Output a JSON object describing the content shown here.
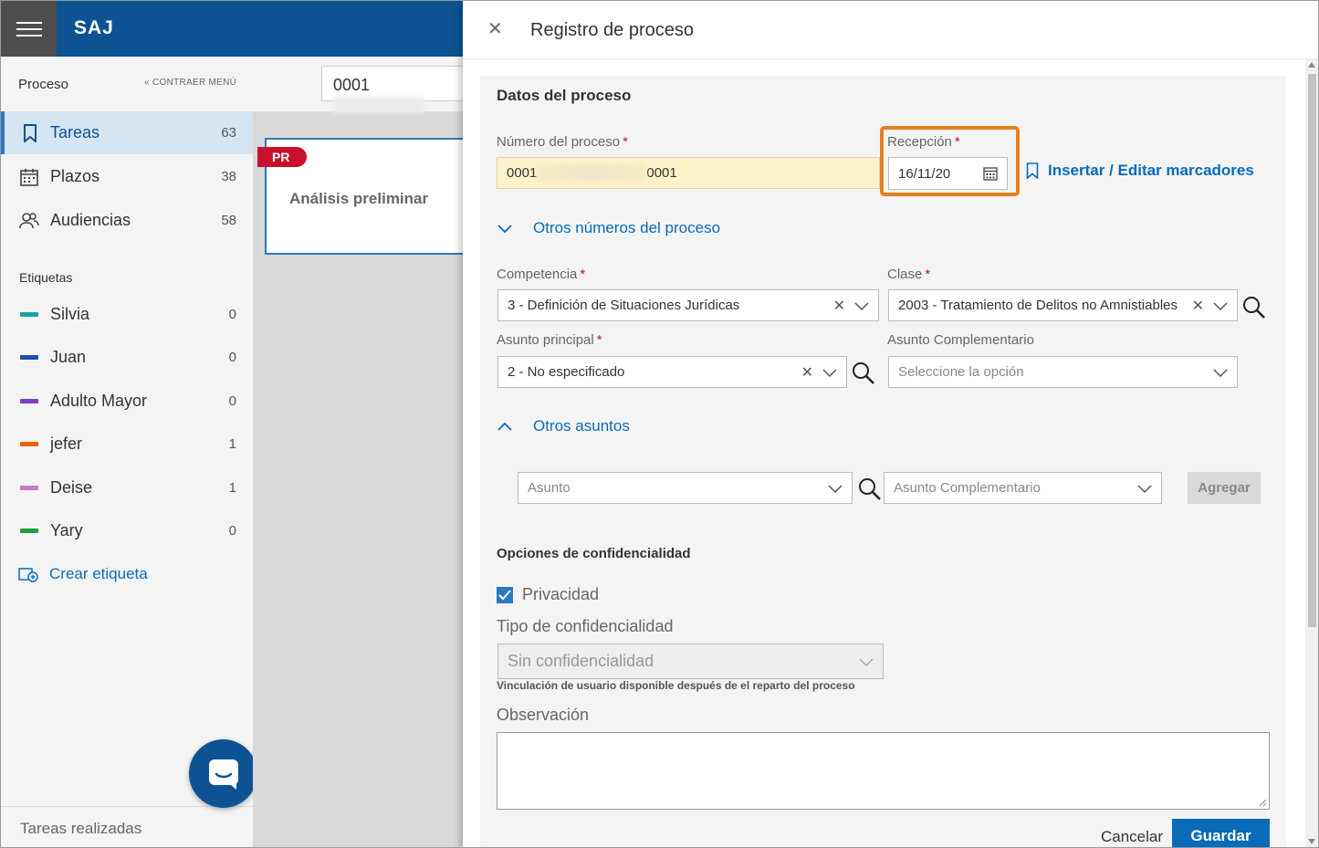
{
  "app": {
    "name": "SAJ"
  },
  "sidebar": {
    "header": "Proceso",
    "collapse_label": "CONTRAER MENÚ",
    "items": [
      {
        "label": "Tareas",
        "count": "63",
        "icon": "bookmark-icon"
      },
      {
        "label": "Plazos",
        "count": "38",
        "icon": "calendar-icon"
      },
      {
        "label": "Audiencias",
        "count": "58",
        "icon": "people-icon"
      }
    ],
    "tags_title": "Etiquetas",
    "tags": [
      {
        "label": "Silvia",
        "count": "0",
        "color": "#1aa3a3"
      },
      {
        "label": "Juan",
        "count": "0",
        "color": "#1f4fa8"
      },
      {
        "label": "Adulto Mayor",
        "count": "0",
        "color": "#7b3fc4"
      },
      {
        "label": "jefer",
        "count": "1",
        "color": "#e8620e"
      },
      {
        "label": "Deise",
        "count": "1",
        "color": "#c77ac0"
      },
      {
        "label": "Yary",
        "count": "0",
        "color": "#1e9e3a"
      }
    ],
    "create_tag": "Crear etiqueta",
    "footer": "Tareas realizadas"
  },
  "main": {
    "search_value": "0001",
    "card": {
      "badge": "PR",
      "title": "Análisis preliminar"
    }
  },
  "panel": {
    "title": "Registro de proceso",
    "section_title": "Datos del proceso",
    "numero": {
      "label": "Número del proceso",
      "prefix": "0001",
      "suffix": "0001"
    },
    "recepcion": {
      "label": "Recepción",
      "value": "16/11/20"
    },
    "marcadores_link": "Insertar / Editar marcadores",
    "otros_numeros": "Otros números del proceso",
    "competencia": {
      "label": "Competencia",
      "value": "3 - Definición de Situaciones Jurídicas"
    },
    "clase": {
      "label": "Clase",
      "value": "2003 - Tratamiento de Delitos no Amnistiables"
    },
    "asunto_principal": {
      "label": "Asunto principal",
      "value": "2 - No especificado"
    },
    "asunto_complementario": {
      "label": "Asunto Complementario",
      "placeholder": "Seleccione la opción"
    },
    "otros_asuntos": "Otros asuntos",
    "asunto_field": {
      "placeholder": "Asunto"
    },
    "asunto_comp_field": {
      "placeholder": "Asunto Complementario"
    },
    "agregar": "Agregar",
    "confid_title": "Opciones de confidencialidad",
    "privacidad": "Privacidad",
    "privacidad_checked": true,
    "tipo_confid": {
      "label": "Tipo de confidencialidad",
      "value": "Sin confidencialidad"
    },
    "hint": "Vinculación de usuario disponible después de el reparto del proceso",
    "observacion": "Observación",
    "cancel": "Cancelar",
    "save": "Guardar"
  },
  "colors": {
    "brand": "#0d5394",
    "accent": "#0a6bb8",
    "highlight": "#e87f1e",
    "required": "#c8102e"
  }
}
